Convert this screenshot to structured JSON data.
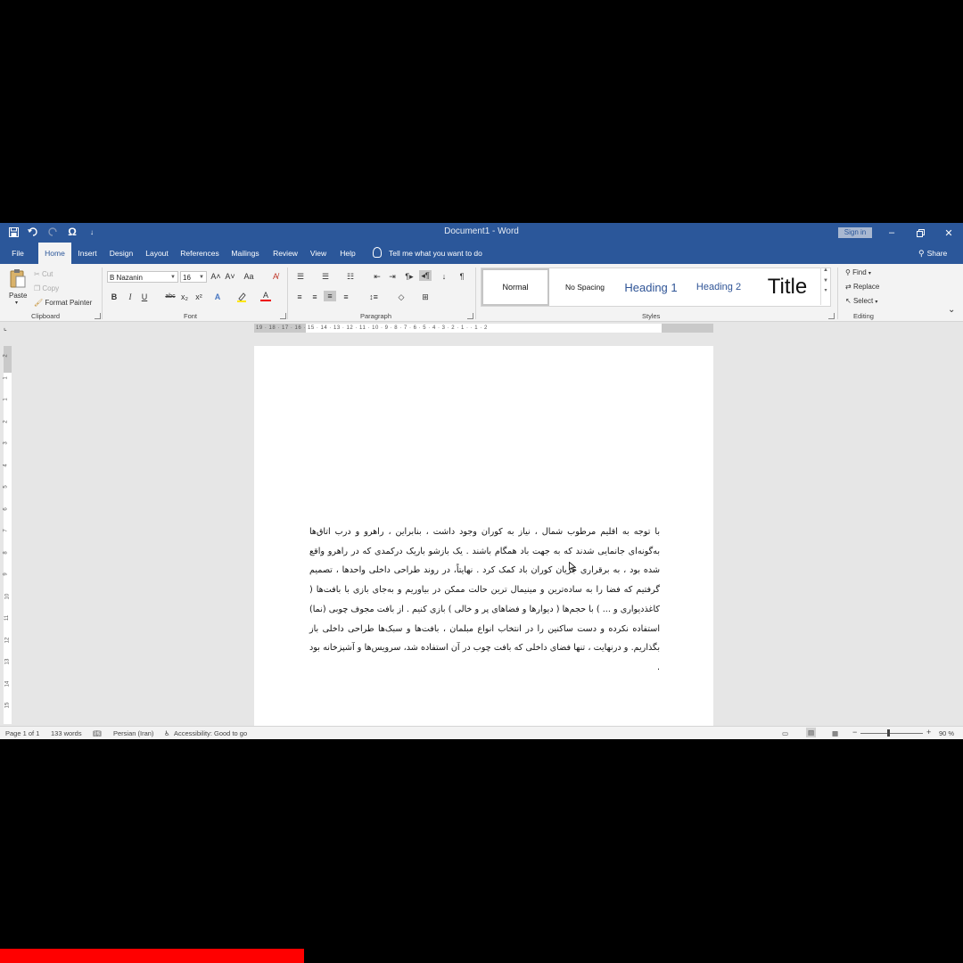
{
  "window": {
    "title": "Document1  -  Word",
    "sign_in": "Sign in",
    "share": "Share"
  },
  "quick_access": {
    "customize": "↓"
  },
  "tabs": [
    "File",
    "Home",
    "Insert",
    "Design",
    "Layout",
    "References",
    "Mailings",
    "Review",
    "View",
    "Help"
  ],
  "active_tab": "Home",
  "tell_me": "Tell me what you want to do",
  "ribbon": {
    "clipboard": {
      "paste": "Paste",
      "cut": "Cut",
      "copy": "Copy",
      "format_painter": "Format Painter",
      "label": "Clipboard"
    },
    "font": {
      "name": "B Nazanin",
      "size": "16",
      "grow": "A˄",
      "shrink": "A˅",
      "case": "Aa",
      "bold": "B",
      "italic": "I",
      "underline": "U",
      "strike": "abc",
      "subscript": "x₂",
      "superscript": "x²",
      "font_color_letter": "A",
      "label": "Font"
    },
    "paragraph": {
      "label": "Paragraph"
    },
    "styles": {
      "items": [
        "Normal",
        "No Spacing",
        "Heading 1",
        "Heading 2",
        "Title"
      ],
      "label": "Styles"
    },
    "editing": {
      "find": "Find",
      "replace": "Replace",
      "select": "Select",
      "label": "Editing"
    }
  },
  "ruler": {
    "horizontal": "19 · 18 · 17 · 16 · 15 · 14 · 13 · 12 · 11 · 10 · 9 · 8 · 7 · 6 · 5 · 4 · 3 · 2 · 1 · · 1 · 2",
    "vertical": [
      "2",
      "1",
      "1",
      "2",
      "3",
      "4",
      "5",
      "6",
      "7",
      "8",
      "9",
      "10",
      "11",
      "12",
      "13",
      "14",
      "15"
    ]
  },
  "document": {
    "paragraph": "با توجه به اقلیم مرطوب شمال ، نیاز به کوران وجود داشت ، بنابراین ، راهرو و درب اتاق‌ها به‌گونه‌ای جانمایی شدند که به جهت باد همگام باشند . یک بازشو باریک درکمدی که در راهرو واقع شده بود ، به برقراری جریان کوران باد کمک کرد . نهایتاً، در روند طراحی داخلی واحدها ، تصمیم گرفتیم که فضا را به ساده‌ترین و مینیمال ترین حالت ممکن در بیاوریم و به‌جای بازی با بافت‌ها ( کاغذدیواری و ... ) با حجم‌ها ( دیوارها و فضاهای پر و خالی ) بازی کنیم . از بافت مجوف چوبی (نما) استفاده نکرده و دست ساکنین را در انتخاب انواع مبلمان ، بافت‌ها و سبک‌ها طراحی داخلی باز بگذاریم. و درنهایت ، تنها فضای داخلی که بافت چوب در آن استفاده شد، سرویس‌ها و آشپزخانه بود ."
  },
  "status_bar": {
    "page": "Page 1 of 1",
    "words": "133 words",
    "language": "Persian (Iran)",
    "accessibility": "Accessibility: Good to go",
    "zoom": "90 %"
  },
  "video_progress": 0.316
}
